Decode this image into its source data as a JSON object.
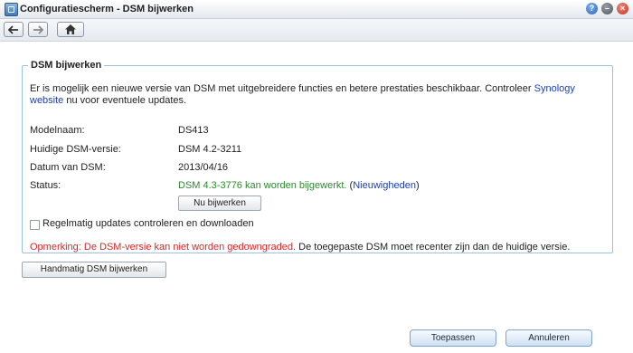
{
  "window": {
    "title": "Configuratiescherm - DSM bijwerken",
    "controls": [
      "help-icon",
      "minimize-icon",
      "close-icon"
    ]
  },
  "toolbar": {
    "icons": [
      "back-arrow-icon",
      "forward-arrow-icon",
      "home-icon"
    ]
  },
  "panel": {
    "legend": "DSM bijwerken",
    "intro_part1": "Er is mogelijk een nieuwe versie van DSM met uitgebreidere functies en betere prestaties beschikbaar. Controleer ",
    "intro_link": "Synology website",
    "intro_part2": " nu voor eventuele updates.",
    "rows": [
      {
        "label": "Modelnaam:",
        "value": "DS413"
      },
      {
        "label": "Huidige DSM-versie:",
        "value": "DSM 4.2-3211"
      },
      {
        "label": "Datum van DSM:",
        "value": "2013/04/16"
      }
    ],
    "status_label": "Status:",
    "status_text": "DSM 4.3-3776 kan worden bijgewerkt.",
    "status_open": " (",
    "status_link": "Nieuwigheden",
    "status_close": ")",
    "update_button": "Nu bijwerken",
    "checkbox_label": "Regelmatig updates controleren en downloaden",
    "checkbox_checked": false,
    "remark_red": "Opmerking: De DSM-versie kan niet worden gedowngraded.",
    "remark_rest": " De toegepaste DSM moet recenter zijn dan de huidige versie."
  },
  "buttons": {
    "manual": "Handmatig DSM bijwerken",
    "apply": "Toepassen",
    "cancel": "Annuleren"
  },
  "colors": {
    "link": "#1a3fb0",
    "status_ok": "#2d8a2d",
    "warning": "#d22a2a",
    "panel_border": "#9dc1e3"
  }
}
